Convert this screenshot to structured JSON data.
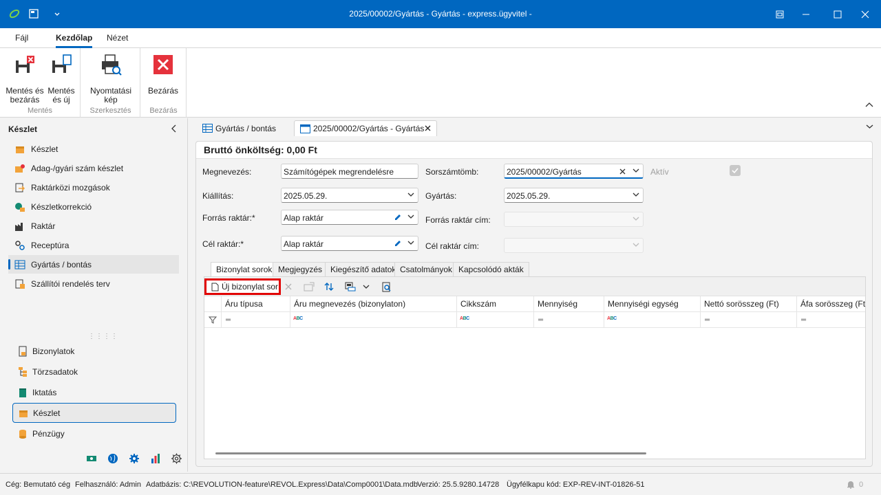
{
  "window": {
    "title": "2025/00002/Gyártás - Gyártás - express.ügyvitel -"
  },
  "menu": {
    "tabs": [
      "Fájl",
      "Kezdőlap",
      "Nézet"
    ],
    "active": "Kezdőlap"
  },
  "ribbon": {
    "groups": [
      {
        "label": "Mentés",
        "buttons": [
          "Mentés és bezárás",
          "Mentés és új"
        ]
      },
      {
        "label": "Szerkesztés",
        "buttons": [
          "Nyomtatási kép"
        ]
      },
      {
        "label": "Bezárás",
        "buttons": [
          "Bezárás"
        ]
      }
    ],
    "btn_save_close_l1": "Mentés és",
    "btn_save_close_l2": "bezárás",
    "btn_save_new_l1": "Mentés",
    "btn_save_new_l2": "és új",
    "btn_print_l1": "Nyomtatási",
    "btn_print_l2": "kép",
    "btn_close": "Bezárás",
    "group_save": "Mentés",
    "group_edit": "Szerkesztés",
    "group_close": "Bezárás"
  },
  "sidebar": {
    "title": "Készlet",
    "items": [
      {
        "label": "Készlet",
        "icon": "box-icon"
      },
      {
        "label": "Adag-/gyári szám készlet",
        "icon": "batch-icon"
      },
      {
        "label": "Raktárközi mozgások",
        "icon": "transfer-icon"
      },
      {
        "label": "Készletkorrekció",
        "icon": "correction-icon"
      },
      {
        "label": "Raktár",
        "icon": "factory-icon"
      },
      {
        "label": "Receptúra",
        "icon": "recipe-icon"
      },
      {
        "label": "Gyártás / bontás",
        "icon": "grid-icon",
        "active": true
      },
      {
        "label": "Szállítói rendelés terv",
        "icon": "plan-icon"
      }
    ],
    "nav": [
      {
        "label": "Bizonylatok",
        "icon": "documents-icon"
      },
      {
        "label": "Törzsadatok",
        "icon": "masterdata-icon"
      },
      {
        "label": "Iktatás",
        "icon": "filing-icon"
      },
      {
        "label": "Készlet",
        "icon": "box-icon",
        "active": true
      },
      {
        "label": "Pénzügy",
        "icon": "coins-icon"
      }
    ]
  },
  "doctabs": [
    {
      "label": "Gyártás / bontás"
    },
    {
      "label": "2025/00002/Gyártás - Gyártás",
      "active": true
    }
  ],
  "form": {
    "heading": "Bruttó önköltség: 0,00 Ft",
    "megnevezes_label": "Megnevezés:",
    "megnevezes_value": "Számítógépek megrendelésre",
    "sorszamtomb_label": "Sorszámtömb:",
    "sorszamtomb_value": "2025/00002/Gyártás",
    "aktiv_label": "Aktív",
    "kiallitas_label": "Kiállítás:",
    "kiallitas_value": "2025.05.29.",
    "gyartas_label": "Gyártás:",
    "gyartas_value": "2025.05.29.",
    "forras_label": "Forrás raktár:*",
    "forras_value": "Alap raktár",
    "forras_cim_label": "Forrás raktár cím:",
    "cel_label": "Cél raktár:*",
    "cel_value": "Alap raktár",
    "cel_cim_label": "Cél raktár cím:"
  },
  "inner_tabs": [
    "Bizonylat sorok",
    "Megjegyzés",
    "Kiegészítő adatok",
    "Csatolmányok",
    "Kapcsolódó akták"
  ],
  "grid": {
    "new_row_label": "Új bizonylat sor",
    "columns": [
      "Áru típusa",
      "Áru megnevezés (bizonylaton)",
      "Cikkszám",
      "Mennyiség",
      "Mennyiségi egység",
      "Nettó sorösszeg (Ft)",
      "Áfa sorösszeg (Ft)"
    ]
  },
  "status": {
    "company": "Cég: Bemutató cég",
    "user": "Felhasználó: Admin",
    "database": "Adatbázis: C:\\REVOLUTION-feature\\REVOL.Express\\Data\\Comp0001\\Data.mdb",
    "version": "Verzió: 25.5.9280.14728",
    "portal": "Ügyfélkapu kód: EXP-REV-INT-01826-51",
    "notifications": "0"
  },
  "colors": {
    "accent": "#0067c0",
    "highlight_border": "#e10000",
    "close_red": "#e5323c"
  }
}
